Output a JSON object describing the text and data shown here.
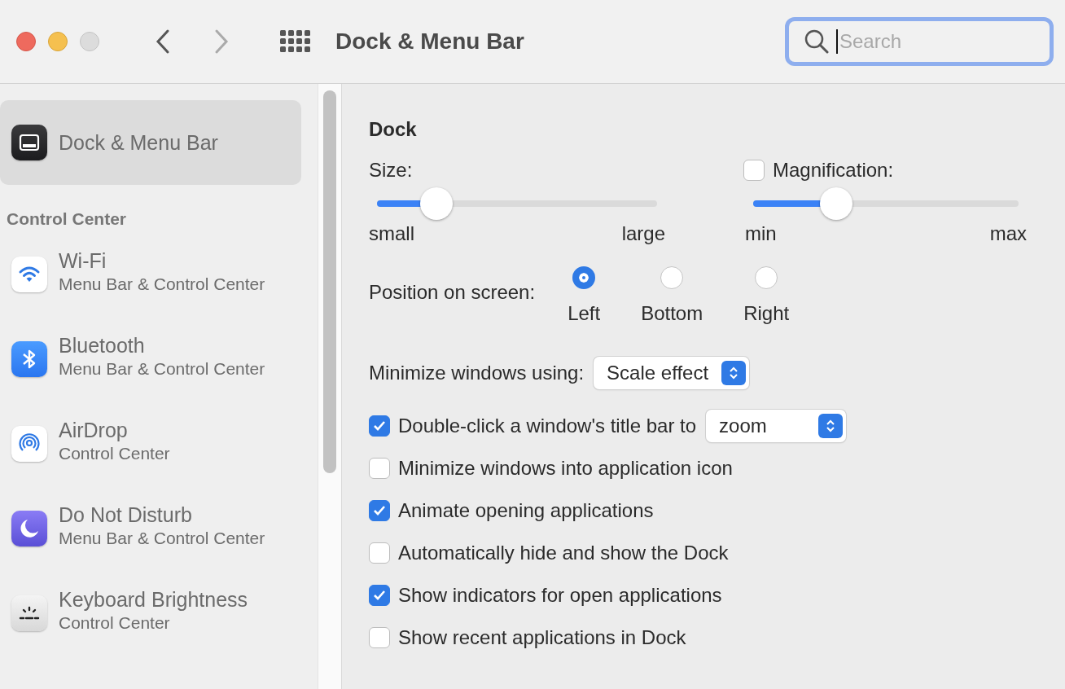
{
  "window": {
    "title": "Dock & Menu Bar"
  },
  "search": {
    "placeholder": "Search"
  },
  "sidebar": {
    "selected_item": {
      "title": "Dock & Menu Bar",
      "selected": true
    },
    "section": "Control Center",
    "items": [
      {
        "title": "Wi-Fi",
        "subtitle": "Menu Bar & Control Center",
        "selected": false
      },
      {
        "title": "Bluetooth",
        "subtitle": "Menu Bar & Control Center",
        "selected": false
      },
      {
        "title": "AirDrop",
        "subtitle": "Control Center",
        "selected": false
      },
      {
        "title": "Do Not Disturb",
        "subtitle": "Menu Bar & Control Center",
        "selected": false
      },
      {
        "title": "Keyboard Brightness",
        "subtitle": "Control Center",
        "selected": false
      }
    ]
  },
  "dock": {
    "heading": "Dock",
    "size": {
      "label": "Size:",
      "level": 0.19,
      "min_label": "small",
      "max_label": "large"
    },
    "magnification": {
      "label": "Magnification:",
      "checked": false,
      "level": 0.28,
      "min_label": "min",
      "max_label": "max"
    },
    "position": {
      "label": "Position on screen:",
      "options": [
        {
          "label": "Left",
          "selected": true
        },
        {
          "label": "Bottom",
          "selected": false
        },
        {
          "label": "Right",
          "selected": false
        }
      ]
    },
    "minimize": {
      "label": "Minimize windows using:",
      "value": "Scale effect"
    },
    "options": [
      {
        "kind": "dropdown",
        "label": "Double-click a window's title bar to",
        "checked": true,
        "value": "zoom"
      },
      {
        "kind": "checkbox",
        "label": "Minimize windows into application icon",
        "checked": false
      },
      {
        "kind": "checkbox",
        "label": "Animate opening applications",
        "checked": true
      },
      {
        "kind": "checkbox",
        "label": "Automatically hide and show the Dock",
        "checked": false
      },
      {
        "kind": "checkbox",
        "label": "Show indicators for open applications",
        "checked": true
      },
      {
        "kind": "checkbox",
        "label": "Show recent applications in Dock",
        "checked": false
      }
    ]
  }
}
